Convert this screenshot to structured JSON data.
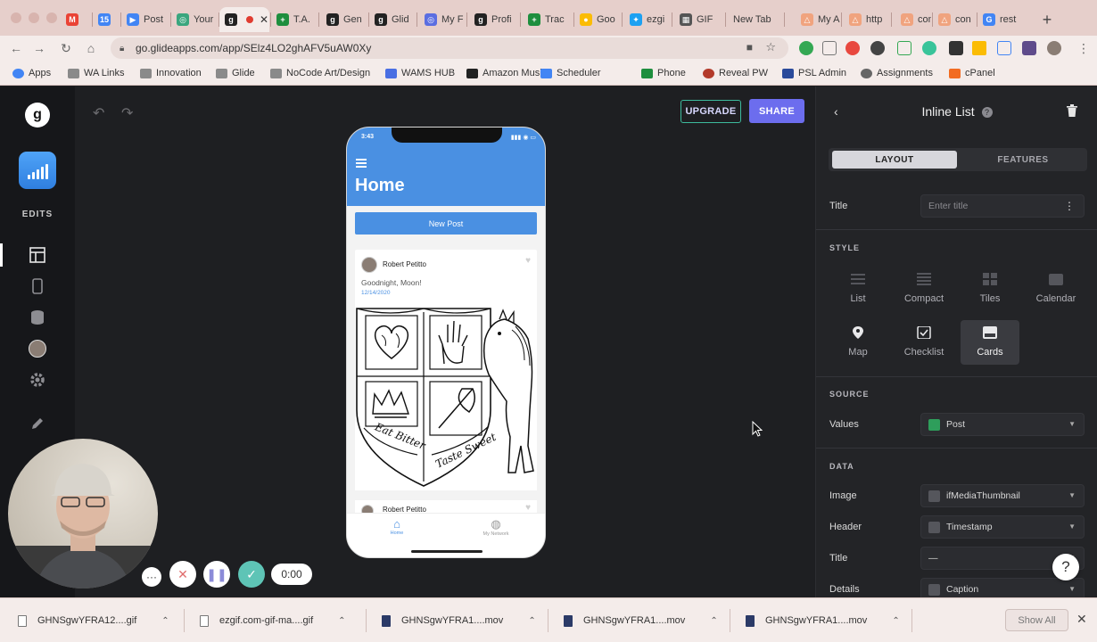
{
  "tabs": [
    {
      "label": "",
      "color": "#ea4335",
      "glyph": "M"
    },
    {
      "label": "",
      "color": "#4285f4",
      "glyph": "15"
    },
    {
      "label": "Post",
      "color": "#4285f4",
      "glyph": "▶"
    },
    {
      "label": "Your",
      "color": "#3aa67e",
      "glyph": "◎"
    },
    {
      "label": "",
      "color": "#222",
      "glyph": "g",
      "active": true
    },
    {
      "label": "T.A.",
      "color": "#1e8e3e",
      "glyph": "+"
    },
    {
      "label": "Gen",
      "color": "#222",
      "glyph": "g"
    },
    {
      "label": "Glid",
      "color": "#222",
      "glyph": "g"
    },
    {
      "label": "My F",
      "color": "#5b6ee1",
      "glyph": "◎"
    },
    {
      "label": "Profi",
      "color": "#222",
      "glyph": "g"
    },
    {
      "label": "Trac",
      "color": "#1e8e3e",
      "glyph": "+"
    },
    {
      "label": "Goo",
      "color": "#fbbc04",
      "glyph": "●"
    },
    {
      "label": "ezgi",
      "color": "#1da1f2",
      "glyph": "✦"
    },
    {
      "label": "GIF",
      "color": "#555",
      "glyph": "▦"
    },
    {
      "label": "New Tab",
      "color": "",
      "glyph": ""
    },
    {
      "label": "My A",
      "color": "#f0a37e",
      "glyph": "△"
    },
    {
      "label": "http",
      "color": "#f0a37e",
      "glyph": "△"
    },
    {
      "label": "con",
      "color": "#f0a37e",
      "glyph": "△"
    },
    {
      "label": "con",
      "color": "#f0a37e",
      "glyph": "△"
    },
    {
      "label": "rest",
      "color": "#4285f4",
      "glyph": "G"
    }
  ],
  "address": {
    "url": "go.glideapps.com/app/SElz4LO2ghAFV5uAW0Xy"
  },
  "bookmarks": [
    {
      "label": "Apps",
      "kind": "apps"
    },
    {
      "label": "WA Links",
      "kind": "folder"
    },
    {
      "label": "Innovation",
      "kind": "folder"
    },
    {
      "label": "Glide",
      "kind": "folder"
    },
    {
      "label": "NoCode Art/Design",
      "kind": "folder"
    },
    {
      "label": "WAMS HUB",
      "kind": "doc"
    },
    {
      "label": "Amazon Music",
      "kind": "amazon"
    },
    {
      "label": "Scheduler",
      "kind": "cal"
    },
    {
      "label": "Phone",
      "kind": "plus"
    },
    {
      "label": "Reveal PW",
      "kind": "reveal"
    },
    {
      "label": "PSL Admin",
      "kind": "psl"
    },
    {
      "label": "Assignments",
      "kind": "gear"
    },
    {
      "label": "cPanel",
      "kind": "cpanel"
    }
  ],
  "leftrail": {
    "edits_label": "EDITS",
    "logo": "g"
  },
  "toolbar": {
    "upgrade_label": "UPGRADE",
    "share_label": "SHARE"
  },
  "phone": {
    "time": "3:43",
    "title": "Home",
    "new_post_label": "New Post",
    "post": {
      "author": "Robert Petitto",
      "text": "Goodnight, Moon!",
      "date": "12/14/2020",
      "motto": "Eat Bitter Taste Sweet"
    },
    "next_author": "Robert Petitto",
    "nav": [
      {
        "label": "Home"
      },
      {
        "label": "My Network"
      }
    ]
  },
  "panel": {
    "title": "Inline List",
    "tabs": {
      "layout": "LAYOUT",
      "features": "FEATURES"
    },
    "title_label": "Title",
    "title_placeholder": "Enter title",
    "style_section": "STYLE",
    "styles": [
      {
        "label": "List",
        "selected": false
      },
      {
        "label": "Compact",
        "selected": false
      },
      {
        "label": "Tiles",
        "selected": false
      },
      {
        "label": "Calendar",
        "selected": false
      },
      {
        "label": "Map",
        "selected": false
      },
      {
        "label": "Checklist",
        "selected": false
      },
      {
        "label": "Cards",
        "selected": true
      }
    ],
    "source_section": "SOURCE",
    "values_label": "Values",
    "values_value": "Post",
    "data_section": "DATA",
    "data_rows": [
      {
        "label": "Image",
        "value": "ifMediaThumbnail"
      },
      {
        "label": "Header",
        "value": "Timestamp"
      },
      {
        "label": "Title",
        "value": "—"
      },
      {
        "label": "Details",
        "value": "Caption"
      }
    ]
  },
  "recorder": {
    "time": "0:00"
  },
  "downloads": [
    {
      "name": "GHNSgwYFRA12....gif"
    },
    {
      "name": "ezgif.com-gif-ma....gif"
    },
    {
      "name": "GHNSgwYFRA1....mov"
    },
    {
      "name": "GHNSgwYFRA1....mov"
    },
    {
      "name": "GHNSgwYFRA1....mov"
    }
  ],
  "shelf": {
    "show_all_label": "Show All"
  },
  "help": {
    "label": "?"
  },
  "colors": {
    "accent": "#6c6dee",
    "phone_header": "#4a90e2",
    "upgrade_border": "#3dbb9d"
  }
}
